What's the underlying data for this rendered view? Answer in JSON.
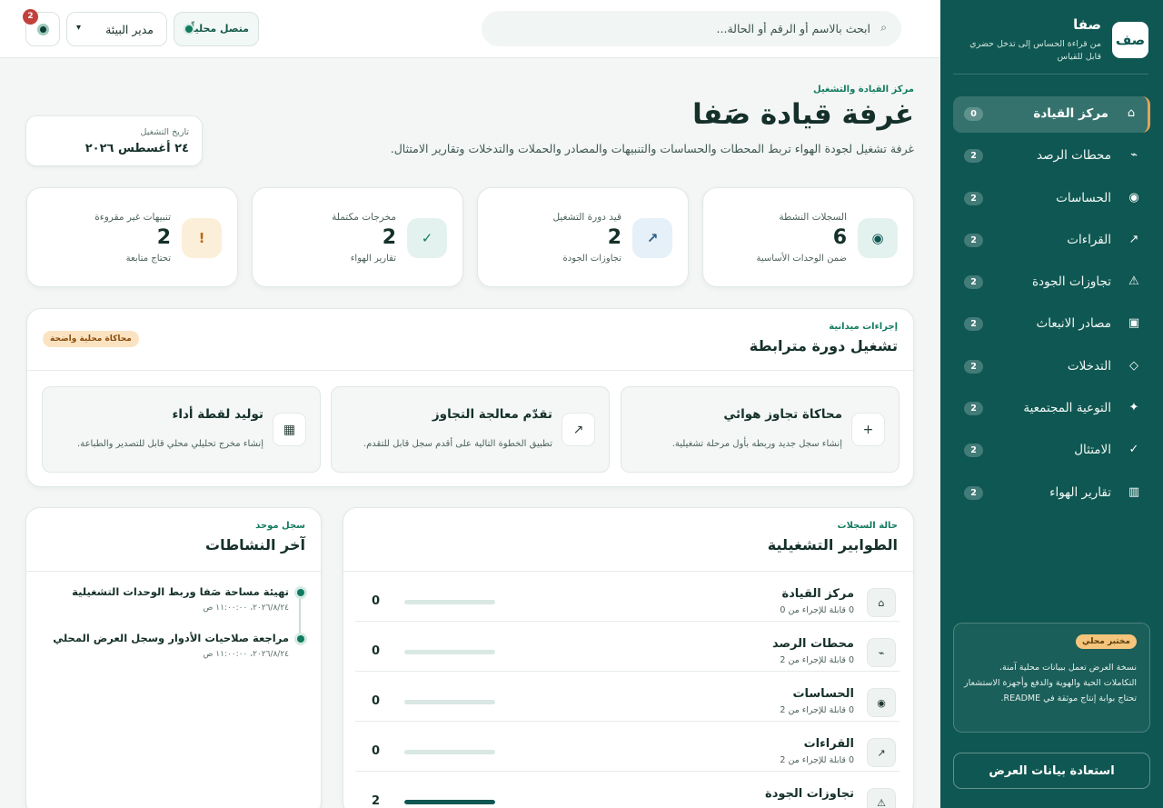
{
  "brand": {
    "logo": "صف",
    "name": "صفا",
    "tagline": "من قراءة الحساس إلى تدخل حضري قابل للقياس"
  },
  "sidebar": {
    "items": [
      {
        "label": "مركز القيادة",
        "count": "0",
        "icon": "⌂",
        "icon_name": "home-icon",
        "active": true
      },
      {
        "label": "محطات الرصد",
        "count": "2",
        "icon": "⌁",
        "icon_name": "station-icon",
        "active": false
      },
      {
        "label": "الحساسات",
        "count": "2",
        "icon": "◉",
        "icon_name": "sensor-icon",
        "active": false
      },
      {
        "label": "القراءات",
        "count": "2",
        "icon": "↗",
        "icon_name": "trend-icon",
        "active": false
      },
      {
        "label": "تجاوزات الجودة",
        "count": "2",
        "icon": "⚠",
        "icon_name": "warning-icon",
        "active": false
      },
      {
        "label": "مصادر الانبعاث",
        "count": "2",
        "icon": "▣",
        "icon_name": "source-icon",
        "active": false
      },
      {
        "label": "التدخلات",
        "count": "2",
        "icon": "◇",
        "icon_name": "diamond-icon",
        "active": false
      },
      {
        "label": "التوعية المجتمعية",
        "count": "2",
        "icon": "✦",
        "icon_name": "sparkle-icon",
        "active": false
      },
      {
        "label": "الامتثال",
        "count": "2",
        "icon": "✓",
        "icon_name": "check-icon",
        "active": false
      },
      {
        "label": "تقارير الهواء",
        "count": "2",
        "icon": "▥",
        "icon_name": "report-icon",
        "active": false
      }
    ],
    "lab": {
      "badge": "مختبر محلي",
      "text": "نسخة العرض تعمل ببيانات محلية آمنة. التكاملات الحية والهوية والدفع وأجهزة الاستشعار تحتاج بوابة إنتاج موثقة في README."
    },
    "restore_label": "استعادة بيانات العرض"
  },
  "topbar": {
    "search_placeholder": "ابحث بالاسم أو الرقم أو الحالة...",
    "connection_label": "متصل محلياً",
    "role_label": "مدير البيئة",
    "notification_count": "2"
  },
  "header": {
    "eyebrow": "مركز القيادة والتشغيل",
    "title": "غرفة قيادة صَفا",
    "description": "غرفة تشغيل لجودة الهواء تربط المحطات والحساسات والتنبيهات والمصادر والحملات والتدخلات وتقارير الامتثال.",
    "date_caption": "تاريخ التشغيل",
    "date_value": "٢٤ أغسطس ٢٠٢٦"
  },
  "stats": [
    {
      "label": "السجلات النشطة",
      "value": "6",
      "hint": "ضمن الوحدات الأساسية",
      "icon": "◉",
      "icon_name": "active-records-icon",
      "bg": "#e4f2ef",
      "fg": "#0f5752"
    },
    {
      "label": "قيد دورة التشغيل",
      "value": "2",
      "hint": "تجاوزات الجودة",
      "icon": "↗",
      "icon_name": "cycle-icon",
      "bg": "#e6f0f8",
      "fg": "#2a5f86"
    },
    {
      "label": "مخرجات مكتملة",
      "value": "2",
      "hint": "تقارير الهواء",
      "icon": "✓",
      "icon_name": "completed-icon",
      "bg": "#e4f2ef",
      "fg": "#127b5f"
    },
    {
      "label": "تنبيهات غير مقروءة",
      "value": "2",
      "hint": "تحتاج متابعة",
      "icon": "!",
      "icon_name": "alert-icon",
      "bg": "#fcefd9",
      "fg": "#b86b12"
    }
  ],
  "actions": {
    "eyebrow": "إجراءات ميدانية",
    "title": "تشغيل دورة مترابطة",
    "badge": "محاكاة محلية واضحة",
    "cards": [
      {
        "title": "محاكاة تجاوز هوائي",
        "desc": "إنشاء سجل جديد وربطه بأول مرحلة تشغيلية.",
        "icon": "+",
        "icon_name": "plus-icon"
      },
      {
        "title": "تقدّم معالجة التجاوز",
        "desc": "تطبيق الخطوة التالية على أقدم سجل قابل للتقدم.",
        "icon": "↗",
        "icon_name": "advance-icon"
      },
      {
        "title": "توليد لقطة أداء",
        "desc": "إنشاء مخرج تحليلي محلي قابل للتصدير والطباعة.",
        "icon": "▦",
        "icon_name": "snapshot-icon"
      }
    ]
  },
  "queues": {
    "eyebrow": "حالة السجلات",
    "title": "الطوابير التشغيلية",
    "rows": [
      {
        "name": "مركز القيادة",
        "sub": "0 قابلة للإجراء من 0",
        "value": "0",
        "fill": 0,
        "icon": "⌂",
        "icon_name": "home-icon"
      },
      {
        "name": "محطات الرصد",
        "sub": "0 قابلة للإجراء من 2",
        "value": "0",
        "fill": 0,
        "icon": "⌁",
        "icon_name": "station-icon"
      },
      {
        "name": "الحساسات",
        "sub": "0 قابلة للإجراء من 2",
        "value": "0",
        "fill": 0,
        "icon": "◉",
        "icon_name": "sensor-icon"
      },
      {
        "name": "القراءات",
        "sub": "0 قابلة للإجراء من 2",
        "value": "0",
        "fill": 0,
        "icon": "↗",
        "icon_name": "trend-icon"
      },
      {
        "name": "تجاوزات الجودة",
        "sub": "",
        "value": "2",
        "fill": 1,
        "icon": "⚠",
        "icon_name": "warning-icon"
      }
    ]
  },
  "activity": {
    "eyebrow": "سجل موحد",
    "title": "آخر النشاطات",
    "items": [
      {
        "title": "تهيئة مساحة صَفا وربط الوحدات التشغيلية",
        "time": "٢٠٢٦/٨/٢٤، ١١:٠٠:٠٠ ص"
      },
      {
        "title": "مراجعة صلاحيات الأدوار وسجل العرض المحلي",
        "time": "٢٠٢٦/٨/٢٤، ١١:٠٠:٠٠ ص"
      }
    ]
  }
}
